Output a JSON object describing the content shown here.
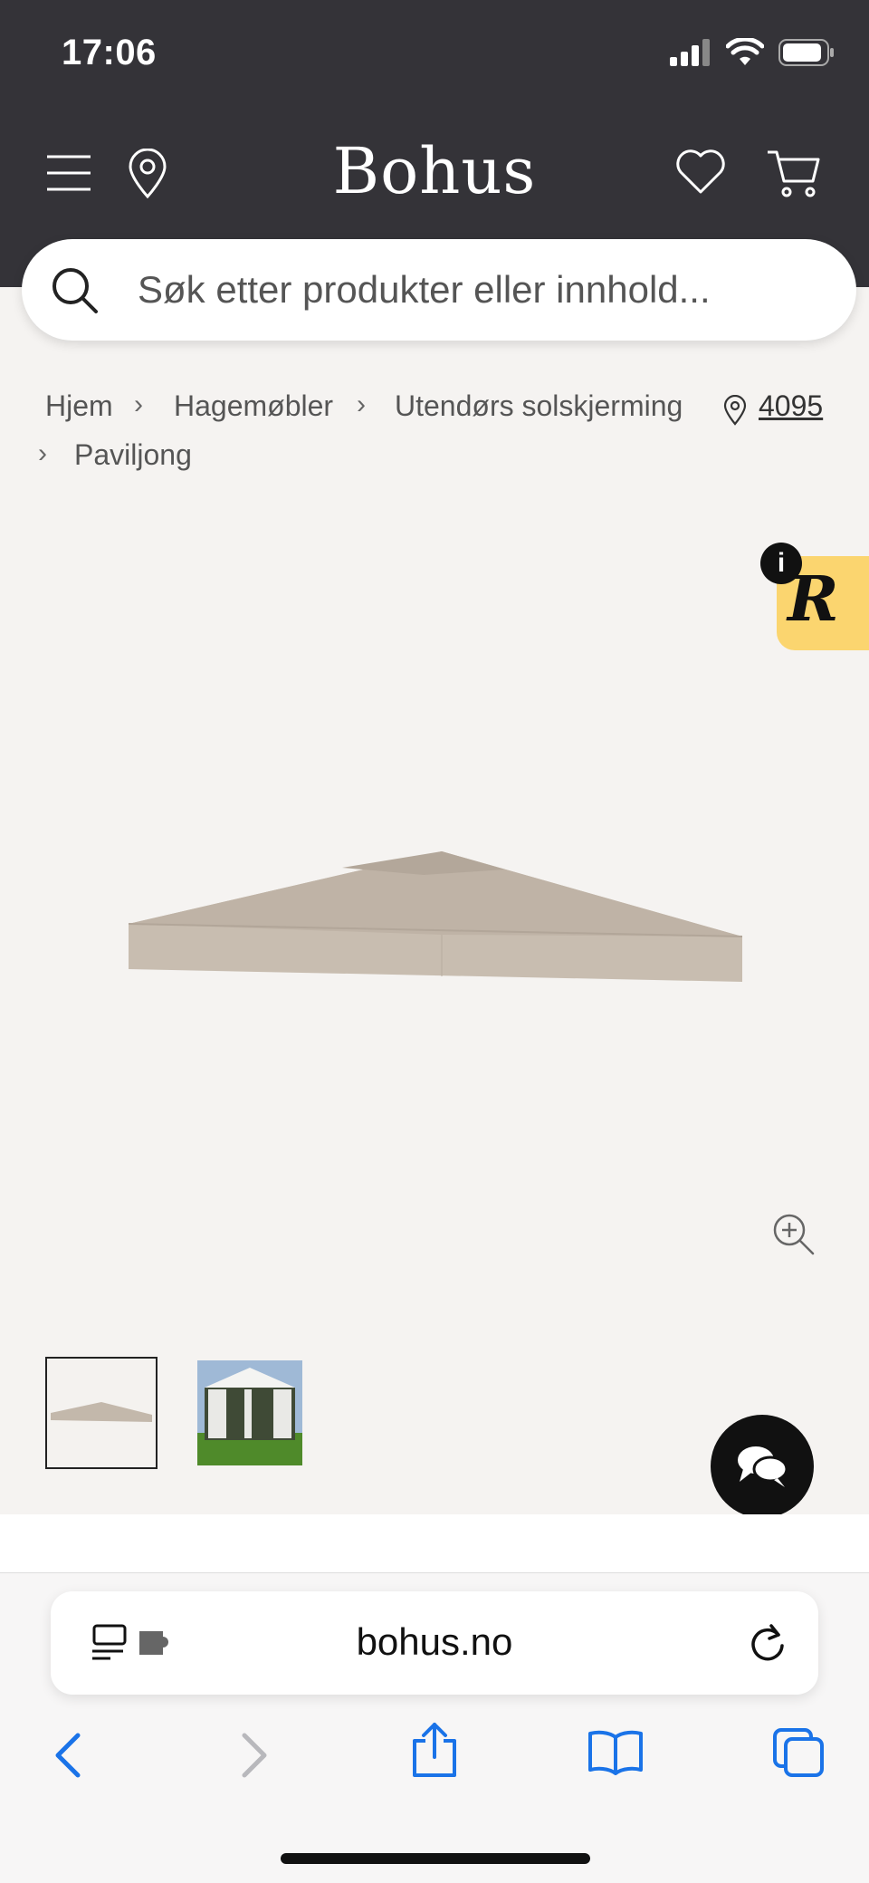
{
  "status": {
    "time": "17:06"
  },
  "header": {
    "brand": "Bohus"
  },
  "search": {
    "placeholder": "Søk etter produkter eller innhold..."
  },
  "breadcrumb": {
    "items": [
      "Hjem",
      "Hagemøbler",
      "Utendørs solskjerming",
      "Paviljong"
    ],
    "store_number": "4095"
  },
  "badge": {
    "letter": "R",
    "info": "i"
  },
  "browser": {
    "url": "bohus.no"
  },
  "colors": {
    "header_bg": "#343338",
    "page_bg": "#f5f3f1",
    "safari_blue": "#1a73e8",
    "badge_yellow": "#fbd56f"
  }
}
